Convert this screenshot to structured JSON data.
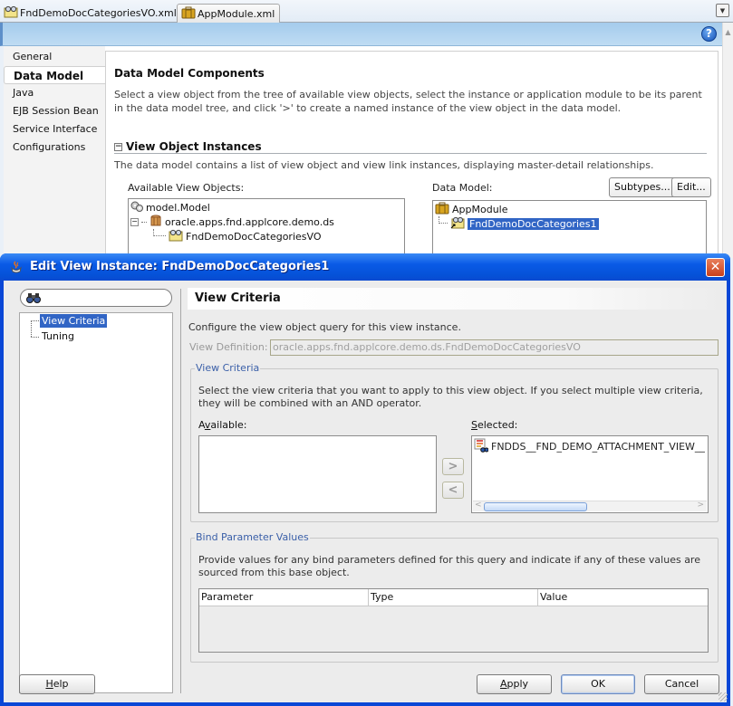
{
  "editor_tabs": [
    {
      "label": "FndDemoDocCategoriesVO.xml",
      "icon": "view-object-icon",
      "active": false
    },
    {
      "label": "AppModule.xml",
      "icon": "app-module-icon",
      "active": true
    }
  ],
  "ide": {
    "nav_items": [
      {
        "label": "General",
        "active": false
      },
      {
        "label": "Data Model",
        "active": true
      },
      {
        "label": "Java",
        "active": false
      },
      {
        "label": "EJB Session Bean",
        "active": false
      },
      {
        "label": "Service Interface",
        "active": false
      },
      {
        "label": "Configurations",
        "active": false
      }
    ],
    "section_title": "Data Model Components",
    "section_desc": "Select a view object from the tree of available view objects, select the instance or application module to be its parent in the data model tree, and click '>' to create a named instance of the view object in the data model.",
    "subsection_title": "View Object Instances",
    "subsection_desc": "The data model contains a list of view object and view link instances, displaying master-detail relationships.",
    "available_label": "Available View Objects:",
    "available_tree": [
      {
        "label": "model.Model",
        "icon": "model-gear-icon"
      },
      {
        "label": "oracle.apps.fnd.applcore.demo.ds",
        "icon": "package-icon"
      },
      {
        "label": "FndDemoDocCategoriesVO",
        "icon": "view-object-icon"
      }
    ],
    "data_model_label": "Data Model:",
    "subtypes_button": "Subtypes...",
    "edit_button": "Edit...",
    "data_model_tree": [
      {
        "label": "AppModule",
        "icon": "app-module-icon"
      },
      {
        "label": "FndDemoDocCategories1",
        "icon": "view-instance-icon",
        "selected": true
      }
    ],
    "help_icon": "?"
  },
  "dialog": {
    "title": "Edit View Instance: FndDemoDocCategories1",
    "close_glyph": "✕",
    "search_value": "",
    "nav_tree": [
      {
        "label": "View Criteria",
        "selected": true
      },
      {
        "label": "Tuning",
        "selected": false
      }
    ],
    "page_title": "View Criteria",
    "config_desc": "Configure the view object query for this view instance.",
    "view_definition_label": "View Definition:",
    "view_definition_value": "oracle.apps.fnd.applcore.demo.ds.FndDemoDocCategoriesVO",
    "view_criteria_group": {
      "legend": "View Criteria",
      "desc": "Select the view criteria that you want to apply to this view object. If you select multiple view criteria, they will be combined with an AND operator.",
      "available_label_pre": "A",
      "available_label_u": "v",
      "available_label_post": "ailable:",
      "selected_label_u": "S",
      "selected_label_post": "elected:",
      "available_items": [],
      "selected_items": [
        "FNDDS__FND_DEMO_ATTACHMENT_VIEW__FND_"
      ],
      "move_right": ">",
      "move_left": "<"
    },
    "bind_group": {
      "legend": "Bind Parameter Values",
      "desc": "Provide values for any bind parameters defined for this query and indicate if any of these values are sourced from this base object.",
      "columns": [
        "Parameter",
        "Type",
        "Value"
      ],
      "rows": []
    },
    "buttons": {
      "help_u": "H",
      "help_rest": "elp",
      "apply_u": "A",
      "apply_rest": "pply",
      "ok": "OK",
      "cancel": "Cancel"
    }
  }
}
